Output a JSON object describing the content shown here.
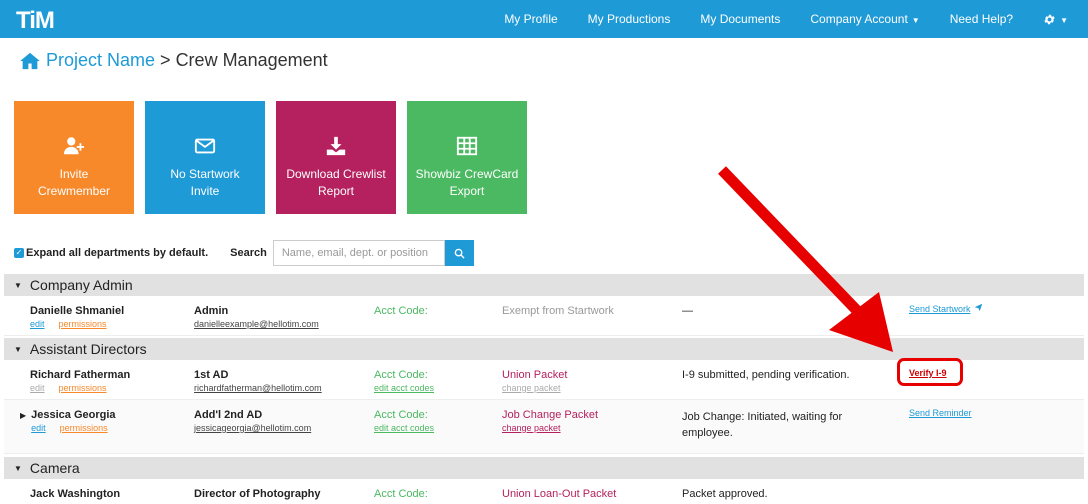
{
  "app": {
    "logo": "TiM"
  },
  "nav": {
    "my_profile": "My Profile",
    "my_productions": "My Productions",
    "my_documents": "My Documents",
    "company_account": "Company Account",
    "need_help": "Need Help?"
  },
  "breadcrumb": {
    "project": "Project Name",
    "separator": ">",
    "page": "Crew Management"
  },
  "tiles": [
    {
      "line1": "Invite",
      "line2": "Crewmember",
      "icon": "add-user-icon",
      "color": "#f7892b"
    },
    {
      "line1": "No Startwork",
      "line2": "Invite",
      "icon": "envelope-icon",
      "color": "#1e9ad6"
    },
    {
      "line1": "Download Crewlist",
      "line2": "Report",
      "icon": "download-icon",
      "color": "#b5215e"
    },
    {
      "line1": "Showbiz CrewCard",
      "line2": "Export",
      "icon": "table-icon",
      "color": "#4bb862"
    }
  ],
  "controls": {
    "expand_label": "Expand all departments by default.",
    "search_label": "Search",
    "search_placeholder": "Name, email, dept. or position"
  },
  "departments": [
    {
      "name": "Company Admin",
      "rows": [
        {
          "name": "Danielle Shmaniel",
          "edit": "edit",
          "permissions": "permissions",
          "role": "Admin",
          "email": "danielleexample@hellotim.com",
          "acct_code": "Acct Code:",
          "packet": "Exempt from Startwork",
          "status": "—",
          "action": "Send Startwork"
        }
      ]
    },
    {
      "name": "Assistant Directors",
      "rows": [
        {
          "name": "Richard Fatherman",
          "edit": "edit",
          "permissions": "permissions",
          "role": "1st AD",
          "email": "richardfatherman@hellotim.com",
          "acct_code": "Acct Code:",
          "acct_sub": "edit acct codes",
          "packet": "Union Packet",
          "packet_sub": "change packet",
          "status": "I-9 submitted, pending verification.",
          "action": "Verify I-9"
        },
        {
          "name": "Jessica Georgia",
          "edit": "edit",
          "permissions": "permissions",
          "role": "Add'l 2nd AD",
          "email": "jessicageorgia@hellotim.com",
          "acct_code": "Acct Code:",
          "acct_sub": "edit acct codes",
          "packet": "Job Change Packet",
          "packet_sub": "change packet",
          "status_line1": "Job Change: Initiated, waiting for",
          "status_line2": "employee.",
          "action": "Send Reminder"
        }
      ]
    },
    {
      "name": "Camera",
      "rows": [
        {
          "name": "Jack Washington",
          "role": "Director of Photography",
          "acct_code": "Acct Code:",
          "packet": "Union Loan-Out Packet",
          "status": "Packet approved."
        }
      ]
    }
  ],
  "colors": {
    "primary": "#1e9ad6",
    "orange": "#f7892b",
    "maroon": "#b5215e",
    "green": "#4bb862",
    "highlight": "#e60000"
  }
}
